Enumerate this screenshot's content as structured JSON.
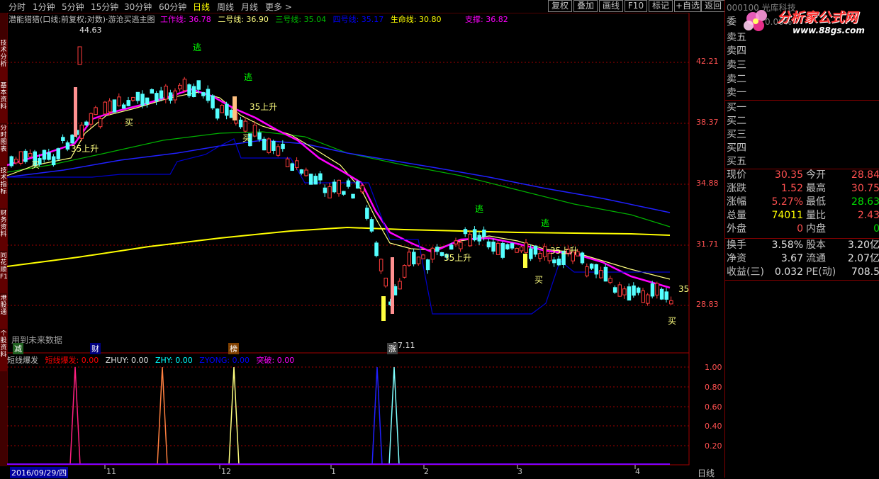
{
  "tabs": [
    "分时",
    "1分钟",
    "5分钟",
    "15分钟",
    "30分钟",
    "60分钟",
    "日线",
    "周线",
    "月线",
    "更多 >"
  ],
  "active_tab": "日线",
  "tool_buttons": [
    "复权",
    "叠加",
    "画线",
    "F10",
    "标记",
    "+自选",
    "返回"
  ],
  "left_strip": [
    "技术分析",
    "基本资料",
    "分时图表",
    "技术指标",
    "财务资料",
    "同花顺F10",
    "港股通",
    "个股资料"
  ],
  "main_legend": {
    "title": "潜能猎猎(口线;前复权;对数)·游沧买逃主图",
    "items": [
      {
        "label": "工作线: 36.78",
        "color": "#ff00ff"
      },
      {
        "label": "二号线: 36.90",
        "color": "#ffff80"
      },
      {
        "label": "三号线: 35.04",
        "color": "#00c000"
      },
      {
        "label": "四号线: 35.17",
        "color": "#0000ff"
      },
      {
        "label": "生命线: 30.80",
        "color": "#ffff00"
      },
      {
        "label": "支撑: 36.82",
        "color": "#ff00ff"
      }
    ]
  },
  "price_axis": [
    "42.21",
    "38.37",
    "34.88",
    "31.71",
    "28.83"
  ],
  "markers": {
    "high": "44.63",
    "low": "27.11",
    "future_note": "用到未来数据",
    "escape": "逃",
    "buy": "买",
    "rise35": "35上升",
    "num35": "35",
    "badge_jian": "减",
    "badge_cai": "财",
    "badge_bang": "榜",
    "badge_zhang": "涨"
  },
  "sub_legend": {
    "title": "短线爆发",
    "items": [
      {
        "label": "短线爆发: 0.00",
        "color": "#ff0000"
      },
      {
        "label": "ZHUY: 0.00",
        "color": "#e0e0e0"
      },
      {
        "label": "ZHY: 0.00",
        "color": "#00ffff"
      },
      {
        "label": "ZYONG: 0.00",
        "color": "#0000ff"
      },
      {
        "label": "突破: 0.00",
        "color": "#ff00ff"
      }
    ]
  },
  "sub_axis": [
    "1.00",
    "0.80",
    "0.60",
    "0.40",
    "0.20"
  ],
  "date_axis": {
    "start": "2016/09/29/四",
    "months": [
      "11",
      "12",
      "1",
      "2",
      "3",
      "4"
    ],
    "period": "日线"
  },
  "quote": {
    "header_stock": "000100 光库科技",
    "header_pct": "0.00%",
    "asks": [
      "卖五",
      "卖四",
      "卖三",
      "卖二",
      "卖一"
    ],
    "bids": [
      "买一",
      "买二",
      "买三",
      "买四",
      "买五"
    ],
    "ask_top": "委",
    "stats": [
      {
        "l1": "现价",
        "v1": "30.35",
        "c1": "red",
        "l2": "今开",
        "v2": "28.84",
        "c2": "red"
      },
      {
        "l1": "涨跌",
        "v1": "1.52",
        "c1": "red",
        "l2": "最高",
        "v2": "30.75",
        "c2": "red"
      },
      {
        "l1": "涨幅",
        "v1": "5.27%",
        "c1": "red",
        "l2": "最低",
        "v2": "28.63",
        "c2": "green"
      },
      {
        "l1": "总量",
        "v1": "74011",
        "c1": "yellow",
        "l2": "量比",
        "v2": "2.43",
        "c2": "red"
      },
      {
        "l1": "外盘",
        "v1": "0",
        "c1": "red",
        "l2": "内盘",
        "v2": "0",
        "c2": "green"
      }
    ],
    "stats2": [
      {
        "l1": "换手",
        "v1": "3.58%",
        "c1": "white",
        "l2": "股本",
        "v2": "3.20亿",
        "c2": "white"
      },
      {
        "l1": "净资",
        "v1": "3.67",
        "c1": "white",
        "l2": "流通",
        "v2": "2.07亿",
        "c2": "white"
      },
      {
        "l1": "收益(三)",
        "v1": "0.032",
        "c1": "white",
        "l2": "PE(动)",
        "v2": "708.5",
        "c2": "white"
      }
    ]
  },
  "watermark": {
    "title": "分析家公式网",
    "url": "www.88gs.com"
  },
  "colors": {
    "bg": "#000000",
    "grid": "#800000",
    "up": "#ff3c3c",
    "down": "#54ffff",
    "accent": "#ffff00"
  }
}
